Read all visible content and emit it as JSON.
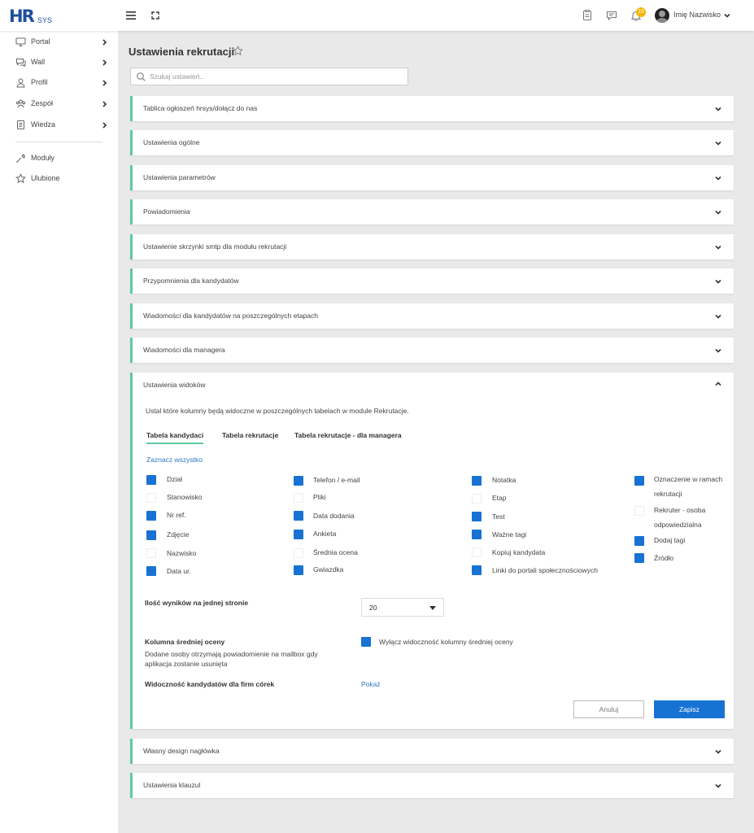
{
  "topbar": {
    "logo_main": "HR",
    "logo_sub": "SYS",
    "notification_count": "10",
    "user_name": "Imię Nazwisko"
  },
  "sidebar": {
    "items": [
      {
        "label": "Portal",
        "icon": "monitor-icon",
        "has_chevron": true
      },
      {
        "label": "Wall",
        "icon": "chat-icon",
        "has_chevron": true
      },
      {
        "label": "Profil",
        "icon": "user-icon",
        "has_chevron": true
      },
      {
        "label": "Zespół",
        "icon": "team-icon",
        "has_chevron": true
      },
      {
        "label": "Wiedza",
        "icon": "book-icon",
        "has_chevron": true
      }
    ],
    "bottom_items": [
      {
        "label": "Moduły",
        "icon": "wrench-icon"
      },
      {
        "label": "Ulubione",
        "icon": "star-icon"
      }
    ]
  },
  "page": {
    "title": "Ustawienia rekrutacji",
    "search_placeholder": "Szukaj ustawień..."
  },
  "sections_top": [
    "Tablica ogłoszeń hrsys/dołącz do nas",
    "Ustawienia ogólne",
    "Ustawienia parametrów",
    "Powiadomienia",
    "Ustawienie skrzynki smtp dla modułu rekrutacji",
    "Przypomnienia dla kandydatów",
    "Wiadomości dla kandydatów na poszczególnych etapach",
    "Wiadomości dla managera"
  ],
  "sections_bottom": [
    "Własny design nagłówka",
    "Ustawienia klauzul"
  ],
  "panel": {
    "title": "Ustawienia widoków",
    "description": "Ustal które kolumny będą widoczne w poszczególnych tabelach w module Rekrutacje.",
    "tabs": [
      "Tabela kandydaci",
      "Tabela rekrutacje",
      "Tabela rekrutacje - dla managera"
    ],
    "active_tab": "Tabela kandydaci",
    "select_all": "Zaznacz wszystko",
    "columns": [
      [
        {
          "label": "Dział",
          "checked": true
        },
        {
          "label": "Stanowisko",
          "checked": false
        },
        {
          "label": "Nr ref.",
          "checked": true
        },
        {
          "label": "Zdjęcie",
          "checked": true
        },
        {
          "label": "Nazwisko",
          "checked": false
        },
        {
          "label": "Data ur.",
          "checked": true
        }
      ],
      [
        {
          "label": "Telefon / e-mail",
          "checked": true
        },
        {
          "label": "Pliki",
          "checked": false
        },
        {
          "label": "Data dodania",
          "checked": true
        },
        {
          "label": "Ankieta",
          "checked": true
        },
        {
          "label": "Średnia ocena",
          "checked": false
        },
        {
          "label": "Gwiazdka",
          "checked": true
        }
      ],
      [
        {
          "label": "Notatka",
          "checked": true
        },
        {
          "label": "Etap",
          "checked": false
        },
        {
          "label": "Test",
          "checked": true
        },
        {
          "label": "Ważne tagi",
          "checked": true
        },
        {
          "label": "Kopiuj kandydata",
          "checked": false
        },
        {
          "label": "Linki do portali społecznościowych",
          "checked": true
        }
      ],
      [
        {
          "label": "Oznaczenie w ramach rekrutacji",
          "checked": true
        },
        {
          "label": "Rekruter - osoba odpowiedzialna",
          "checked": false
        },
        {
          "label": "Dodaj tagi",
          "checked": true
        },
        {
          "label": "Źródło",
          "checked": true
        }
      ]
    ],
    "results_label": "Ilość wyników na jednej stronie",
    "results_value": "20",
    "avg_label": "Kolumna średniej oceny",
    "avg_desc_1": "Dodane osoby otrzymają powiadomienie na mailbox gdy",
    "avg_desc_2": "aplikacja zostanie usunięta",
    "avg_checkbox_label": "Wyłącz widoczność kolumny średniej oceny",
    "avg_checkbox_checked": true,
    "visibility_label": "Widoczność kandydatów dla firm córek",
    "visibility_link": "Pokaż",
    "cancel_label": "Anuluj",
    "save_label": "Zapisz"
  },
  "colors": {
    "accent": "#5ecb9f",
    "primary": "#1872d3",
    "link": "#2b78c2",
    "badge": "#f2b705",
    "brand": "#1d4f9c"
  }
}
